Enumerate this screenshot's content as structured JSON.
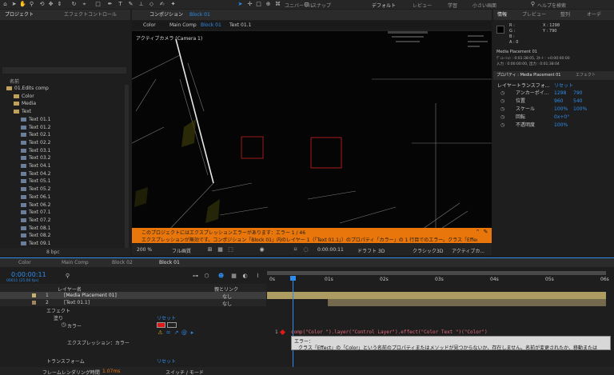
{
  "toolbar": {
    "snap_label": "スナップ",
    "workspaces": [
      "デフォルト",
      "レビュー",
      "学習",
      "小さい画面"
    ],
    "search_placeholder": "ヘルプを検索",
    "universal_label": "ユニバーサル"
  },
  "project": {
    "tabs": [
      "プロジェクト",
      "エフェクトコントロール"
    ],
    "search_placeholder": "",
    "col_name": "名前",
    "items": [
      {
        "label": "01.Edits comp",
        "indent": 0,
        "type": "folder-open"
      },
      {
        "label": "Color",
        "indent": 1,
        "type": "folder"
      },
      {
        "label": "Media",
        "indent": 1,
        "type": "folder"
      },
      {
        "label": "Text",
        "indent": 1,
        "type": "folder-open"
      },
      {
        "label": "Text 01.1",
        "indent": 2,
        "type": "comp"
      },
      {
        "label": "Text 01.2",
        "indent": 2,
        "type": "comp"
      },
      {
        "label": "Text 02.1",
        "indent": 2,
        "type": "comp"
      },
      {
        "label": "Text 02.2",
        "indent": 2,
        "type": "comp"
      },
      {
        "label": "Text 03.1",
        "indent": 2,
        "type": "comp"
      },
      {
        "label": "Text 03.2",
        "indent": 2,
        "type": "comp"
      },
      {
        "label": "Text 04.1",
        "indent": 2,
        "type": "comp"
      },
      {
        "label": "Text 04.2",
        "indent": 2,
        "type": "comp"
      },
      {
        "label": "Text 05.1",
        "indent": 2,
        "type": "comp"
      },
      {
        "label": "Text 05.2",
        "indent": 2,
        "type": "comp"
      },
      {
        "label": "Text 06.1",
        "indent": 2,
        "type": "comp"
      },
      {
        "label": "Text 06.2",
        "indent": 2,
        "type": "comp"
      },
      {
        "label": "Text 07.1",
        "indent": 2,
        "type": "comp"
      },
      {
        "label": "Text 07.2",
        "indent": 2,
        "type": "comp"
      },
      {
        "label": "Text 08.1",
        "indent": 2,
        "type": "comp"
      },
      {
        "label": "Text 08.2",
        "indent": 2,
        "type": "comp"
      },
      {
        "label": "Text 09.1",
        "indent": 2,
        "type": "comp"
      }
    ],
    "bpc": "8 bpc"
  },
  "comp": {
    "tab_prefix": "コンポジション",
    "tab_name": "Block 01",
    "breadcrumbs": [
      "Color",
      "Main Comp",
      "Block 01",
      "Text 01.1"
    ],
    "camera_label": "アクティブカメラ (Camera 1)",
    "error_banner": "このプロジェクトにはエクスプレッションエラーがあります：エラー 1 / 46",
    "error_detail": "エクスプレッションが無効です。コンポジション「Block 01」内のレイヤー 1（「Text 01.1」）のプロパティ「カラー」の 1 行目でのエラー。クラス「Effect」の「Color」という名前のプ",
    "zoom": "200 %",
    "quality": "フル画質",
    "timecode": "0:00:00:11",
    "renderer": "クラシック3D",
    "camera_view": "アクティブカ...",
    "draft": "ドラフト 3D"
  },
  "info": {
    "tabs": [
      "情報",
      "プレビュー",
      "整列",
      "オーデ"
    ],
    "rgb": [
      "R :",
      "G :",
      "B :",
      "A : 0"
    ],
    "xy": [
      "X : 1298",
      "Y : 790"
    ],
    "layer_name": "Media Placement 01",
    "lines": [
      "ﾃﾞｭﾚｰｼｮﾝ : 0:01:38:05, ｽﾀｰﾄ : +0:00:00:00",
      "入力 : 0:00:00:00, 出力 : 0:01:38:04"
    ]
  },
  "props": {
    "tab": "プロパティ : Media Placement 01",
    "tab2": "エフェクト",
    "section": "レイヤートランスフォ...",
    "reset": "リセット",
    "items": [
      {
        "label": "アンカーポイ...",
        "v1": "1298",
        "v2": "790"
      },
      {
        "label": "位置",
        "v1": "960",
        "v2": "540"
      },
      {
        "label": "スケール",
        "v1": "100%",
        "v2": "100%"
      },
      {
        "label": "回転",
        "v1": "0x+0°",
        "v2": ""
      },
      {
        "label": "不透明度",
        "v1": "100%",
        "v2": ""
      }
    ]
  },
  "timeline": {
    "tabs": [
      "Color",
      "Main Comp",
      "Block 02",
      "Block 01"
    ],
    "timecode": "0:00:00:11",
    "fps": "00011 (25.00 fps)",
    "col_layer": "レイヤー名",
    "col_parent": "親とリンク",
    "layers": [
      {
        "num": "1",
        "name": "[Media Placement 01]",
        "parent": "なし"
      },
      {
        "num": "2",
        "name": "[Text 01.1]",
        "parent": "なし"
      }
    ],
    "ruler": [
      "0s",
      "01s",
      "02s",
      "03s",
      "04s",
      "05s",
      "06s"
    ],
    "effects_label": "エフェクト",
    "fill_label": "塗り",
    "reset1": "リセット",
    "color_label": "カラー",
    "expr_label": "エクスプレッション：カラー",
    "transform_label": "トランスフォーム",
    "reset2": "リセット",
    "expression": "comp(\"Color \").layer(\"Control Layer\").effect(\"Color Text \")(\"Color\")",
    "error_title": "エラー：",
    "error_text": "クラス「Effect」の「Color」という名前のプロパティまたはメソッドが見つからないか、存在しません。名前が変更されたか、移動または",
    "footer_render": "フレームレンダリング時間",
    "footer_ms": "1.07ms",
    "footer_switch": "スイッチ / モード",
    "line_num": "1"
  },
  "colors": {
    "accent": "#2d8ceb",
    "error": "#e8760a",
    "red": "#e01818",
    "expr": "#e46a7a"
  }
}
